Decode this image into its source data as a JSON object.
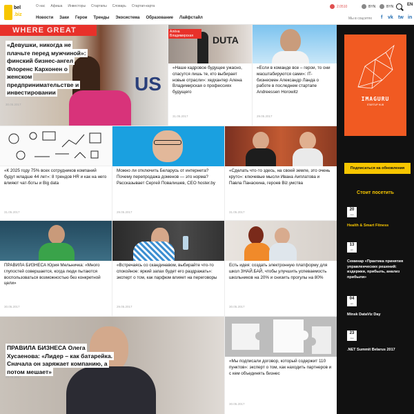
{
  "header": {
    "logo_bel": "bel",
    "logo_biz": ".biz",
    "top_links": [
      "О нас",
      "Афиша",
      "Инвесторы",
      "Стартапы",
      "Словарь",
      "Стартап-карта"
    ],
    "main_nav": [
      "Новости",
      "Заки",
      "Герои",
      "Тренды",
      "Экосистема",
      "Образование",
      "Лайфстайл"
    ],
    "currencies": [
      {
        "label": "USD",
        "value": "2.0510",
        "color": "#e05050"
      },
      {
        "label": "BYN",
        "value": "",
        "color": "#888888"
      },
      {
        "label": "BYN",
        "value": "",
        "color": "#888888"
      }
    ],
    "lang": "EN",
    "social_label": "Мы в соцсетях",
    "social": [
      "f",
      "vk",
      "tw",
      "in"
    ]
  },
  "tiles": [
    {
      "caption": "«Девушки, никогда не плачьте перед мужчиной»: финский бизнес-ангел Флоренс Кархонен о женском предпринимательстве и инвестировании",
      "date": "30.05.2017",
      "photo_text": "WHERE GREAT",
      "photo_text2": "US"
    },
    {
      "caption": "«Наше кадровое будущее ужасно, спасутся лишь те, кто выбирает новые отрасли»: хедхантер Алена Владимирская о профессиях будущего",
      "date": "31.05.2017",
      "label": "Алёна Владимирская",
      "photo_text": "DUTA"
    },
    {
      "caption": "«Если в команде все – герои, то они масштабируются сами»: IT-бизнесмен Александр Ланда о работе в последнем стартапе Andreessen Horowitz",
      "date": "29.05.2017"
    },
    {
      "caption": "«К 2025 году 75% всех сотрудников компаний будут младше 44 лет»: 8 трендов HR и как на него влияют чат-боты и Big data",
      "date": "31.05.2017"
    },
    {
      "caption": "Можно ли отключить Беларусь от интернета? Почему перепродажа доменов — это норма? Рассказывает Сергей Повалишев, CEO hoster.by",
      "date": "29.05.2017"
    },
    {
      "caption": "«Сделать что-то здесь, на своей земле, это очень круто»: ключевые мысли Ивана Аиплатова и Павла Панаскина, героев Biz.умства",
      "date": "31.05.2017"
    },
    {
      "caption": "ПРАВИЛА БИЗНЕСА Юрия Мельничка: «Много глупостей совершается, когда люди пытаются воспользоваться возможностью без конкретной цели»",
      "date": "30.05.2017"
    },
    {
      "caption": "«Встречаясь со скандинавом, выбирайте что-то спокойное: яркий запах будет его раздражать»: эксперт о том, как парфюм влияет на переговоры",
      "date": "29.05.2017"
    },
    {
      "caption": "Есть идея: создать электронную платформу для школ ЗНАЙ.БАЙ, чтобы улучшить успеваемость школьников на 20% и снизить прогулы на 80%",
      "date": "30.05.2017"
    },
    {
      "caption": "ПРАВИЛА БИЗНЕСА Олега Хусаенова: «Лидер – как батарейка. Сначала он заряжает компанию, а потом мешает»",
      "date": "29.05.2017"
    },
    {
      "caption": "«Мы подписали договор, который содержит 110 пунктов»: эксперт о том, как находить партнеров и с кем объединять бизнес",
      "date": "30.05.2017"
    }
  ],
  "sidebar": {
    "banner_title": "IMAGURU",
    "banner_sub": "STARTUP HUB",
    "subscribe_label": "Подписаться на обновления",
    "events_title": "Стоит посетить",
    "events": [
      {
        "day": "20",
        "month": "сен",
        "title": "Health & Smart Fitness",
        "highlight": true
      },
      {
        "day": "13",
        "month": "окт",
        "title": "Семинар «Практика принятия управленческих решений: издержки, прибыль, анализ прибыли»",
        "highlight": false
      },
      {
        "day": "04",
        "month": "окт",
        "title": "Minsk DataViz Day",
        "highlight": false
      },
      {
        "day": "23",
        "month": "сен",
        "title": ".NET Summit Belarus 2017",
        "highlight": false
      }
    ]
  },
  "colors": {
    "accent_yellow": "#f7c600",
    "sidebar_bg": "#111111",
    "banner_orange": "#f15a22",
    "label_red": "#e8312a"
  }
}
